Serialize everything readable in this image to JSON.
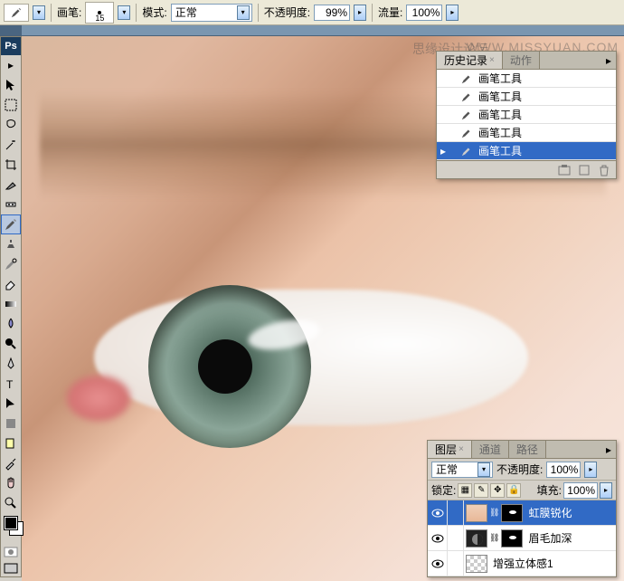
{
  "options_bar": {
    "brush_label": "画笔:",
    "brush_size": "15",
    "mode_label": "模式:",
    "mode_value": "正常",
    "opacity_label": "不透明度:",
    "opacity_value": "99%",
    "flow_label": "流量:",
    "flow_value": "100%"
  },
  "watermark": {
    "cn": "思缘设计论坛",
    "en": "WWW.MISSYUAN.COM"
  },
  "history_panel": {
    "tab_history": "历史记录",
    "tab_actions": "动作",
    "items": [
      {
        "label": "画笔工具"
      },
      {
        "label": "画笔工具"
      },
      {
        "label": "画笔工具"
      },
      {
        "label": "画笔工具"
      },
      {
        "label": "画笔工具"
      }
    ]
  },
  "layers_panel": {
    "tab_layers": "图层",
    "tab_channels": "通道",
    "tab_paths": "路径",
    "blend_mode": "正常",
    "opacity_label": "不透明度:",
    "opacity_value": "100%",
    "lock_label": "锁定:",
    "fill_label": "填充:",
    "fill_value": "100%",
    "layers": [
      {
        "name": "虹膜锐化",
        "selected": true,
        "has_mask": true,
        "thumb": "face"
      },
      {
        "name": "眉毛加深",
        "selected": false,
        "has_mask": true,
        "thumb": "dark"
      },
      {
        "name": "增强立体感1",
        "selected": false,
        "has_mask": false,
        "thumb": "checker"
      }
    ]
  },
  "ps_logo": "Ps"
}
